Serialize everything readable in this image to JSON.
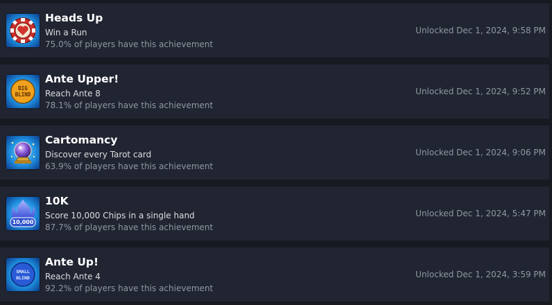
{
  "achievements": [
    {
      "title": "Heads Up",
      "description": "Win a Run",
      "percent_text": "75.0% of players have this achievement",
      "unlocked_text": "Unlocked Dec 1, 2024, 9:58 PM",
      "icon": "poker-chip-heart-icon"
    },
    {
      "title": "Ante Upper!",
      "description": "Reach Ante 8",
      "percent_text": "78.1% of players have this achievement",
      "unlocked_text": "Unlocked Dec 1, 2024, 9:52 PM",
      "icon": "big-blind-chip-icon",
      "icon_text": "BIG BLIND"
    },
    {
      "title": "Cartomancy",
      "description": "Discover every Tarot card",
      "percent_text": "63.9% of players have this achievement",
      "unlocked_text": "Unlocked Dec 1, 2024, 9:06 PM",
      "icon": "crystal-ball-icon"
    },
    {
      "title": "10K",
      "description": "Score 10,000 Chips in a single hand",
      "percent_text": "87.7% of players have this achievement",
      "unlocked_text": "Unlocked Dec 1, 2024, 5:47 PM",
      "icon": "blue-flame-10000-icon",
      "icon_text": "10,000"
    },
    {
      "title": "Ante Up!",
      "description": "Reach Ante 4",
      "percent_text": "92.2% of players have this achievement",
      "unlocked_text": "Unlocked Dec 1, 2024, 3:59 PM",
      "icon": "small-blind-chip-icon",
      "icon_text": "SMALL BLIND"
    }
  ],
  "colors": {
    "background": "#171a21",
    "row_background": "#212532",
    "title": "#ffffff",
    "description": "#dcdedf",
    "muted": "#8f98a0",
    "icon_blue": "#1f8fe0",
    "icon_dark_blue": "#0b3d8c"
  }
}
